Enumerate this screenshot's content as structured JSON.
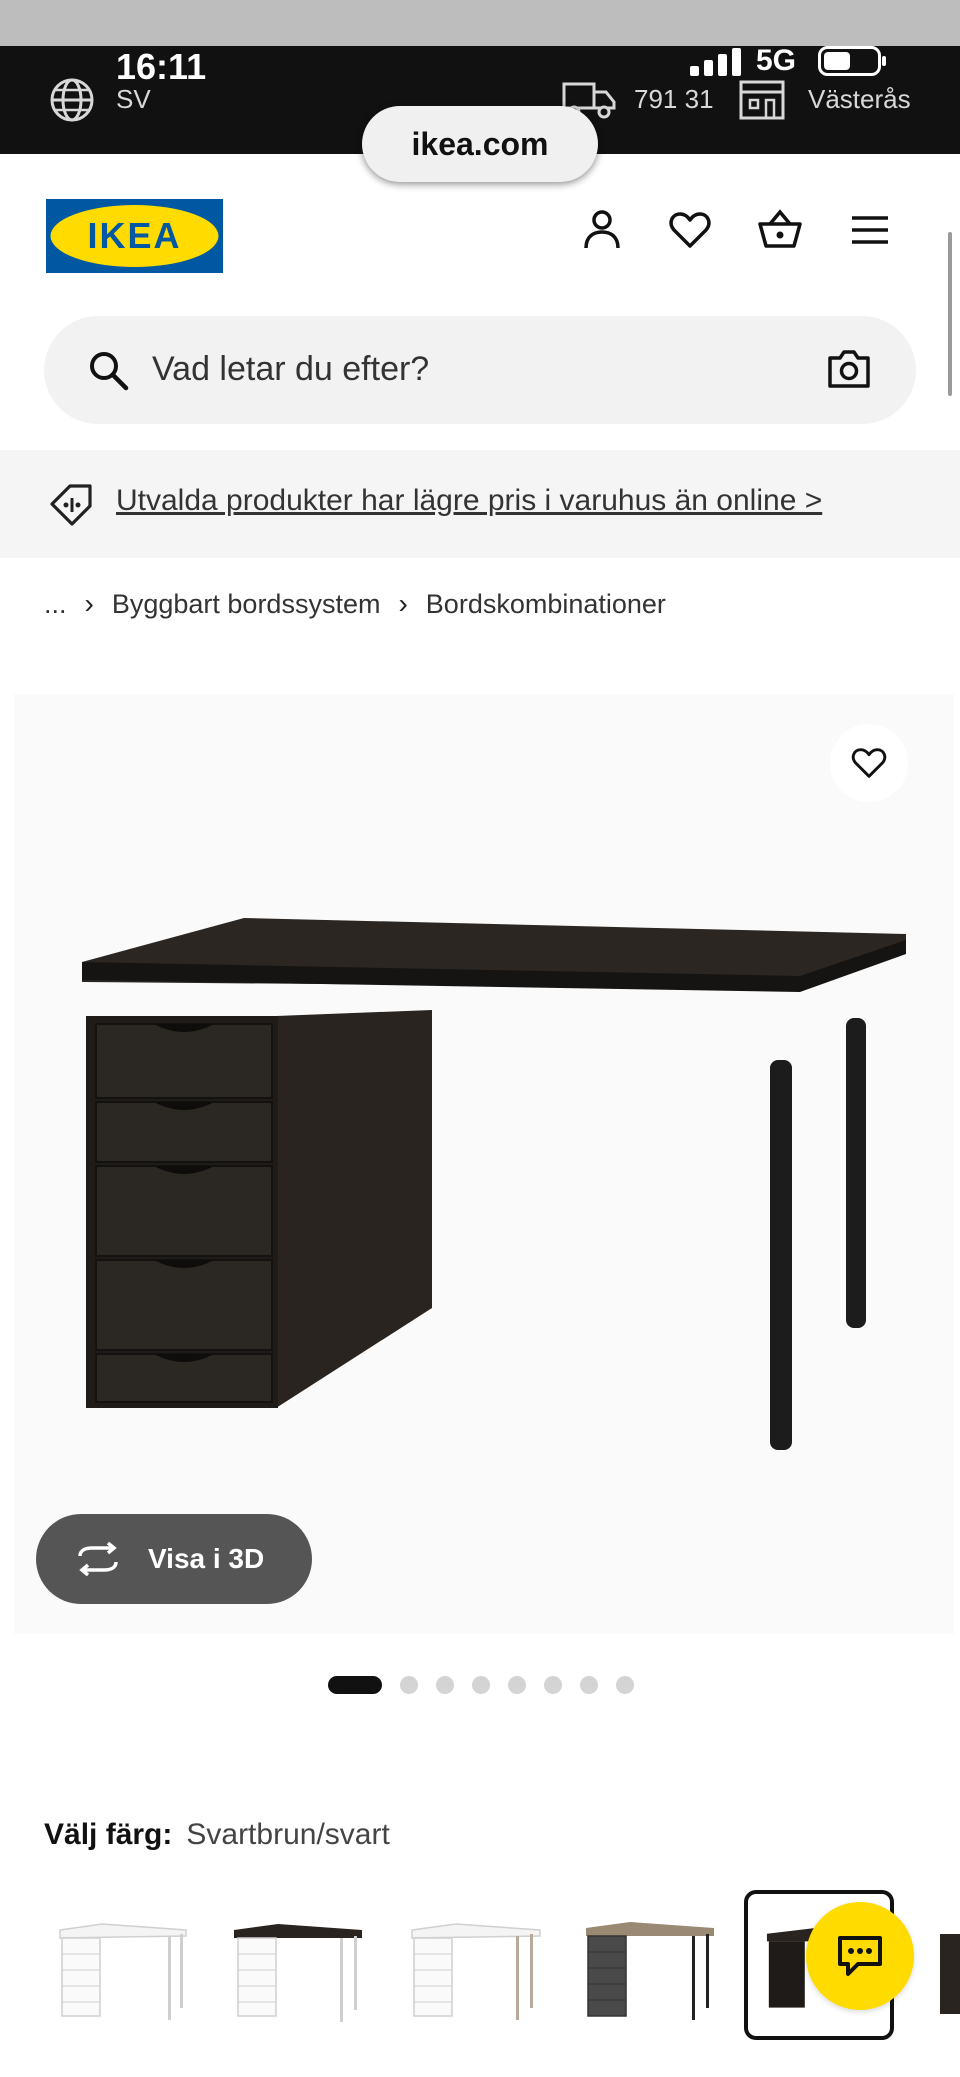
{
  "status_bar": {
    "time": "16:11",
    "language": "SV",
    "network": "5G",
    "postal_code": "791 31",
    "store": "Västerås"
  },
  "browser": {
    "url": "ikea.com"
  },
  "header": {
    "logo_text": "IKEA",
    "icons": [
      "user-icon",
      "heart-icon",
      "basket-icon",
      "menu-icon"
    ],
    "brand_colors": {
      "blue": "#0058a3",
      "yellow": "#ffdb00"
    }
  },
  "search": {
    "placeholder": "Vad letar du efter?"
  },
  "promo": {
    "text": "Utvalda produkter har lägre pris i varuhus än online >"
  },
  "breadcrumb": {
    "items": [
      "...",
      "Byggbart bordssystem",
      "Bordskombinationer"
    ]
  },
  "gallery": {
    "view3d_label": "Visa i 3D",
    "dot_count": 8,
    "active_index": 0
  },
  "color": {
    "label": "Välj färg:",
    "value": "Svartbrun/svart",
    "swatch_count": 6,
    "selected_index": 4
  }
}
